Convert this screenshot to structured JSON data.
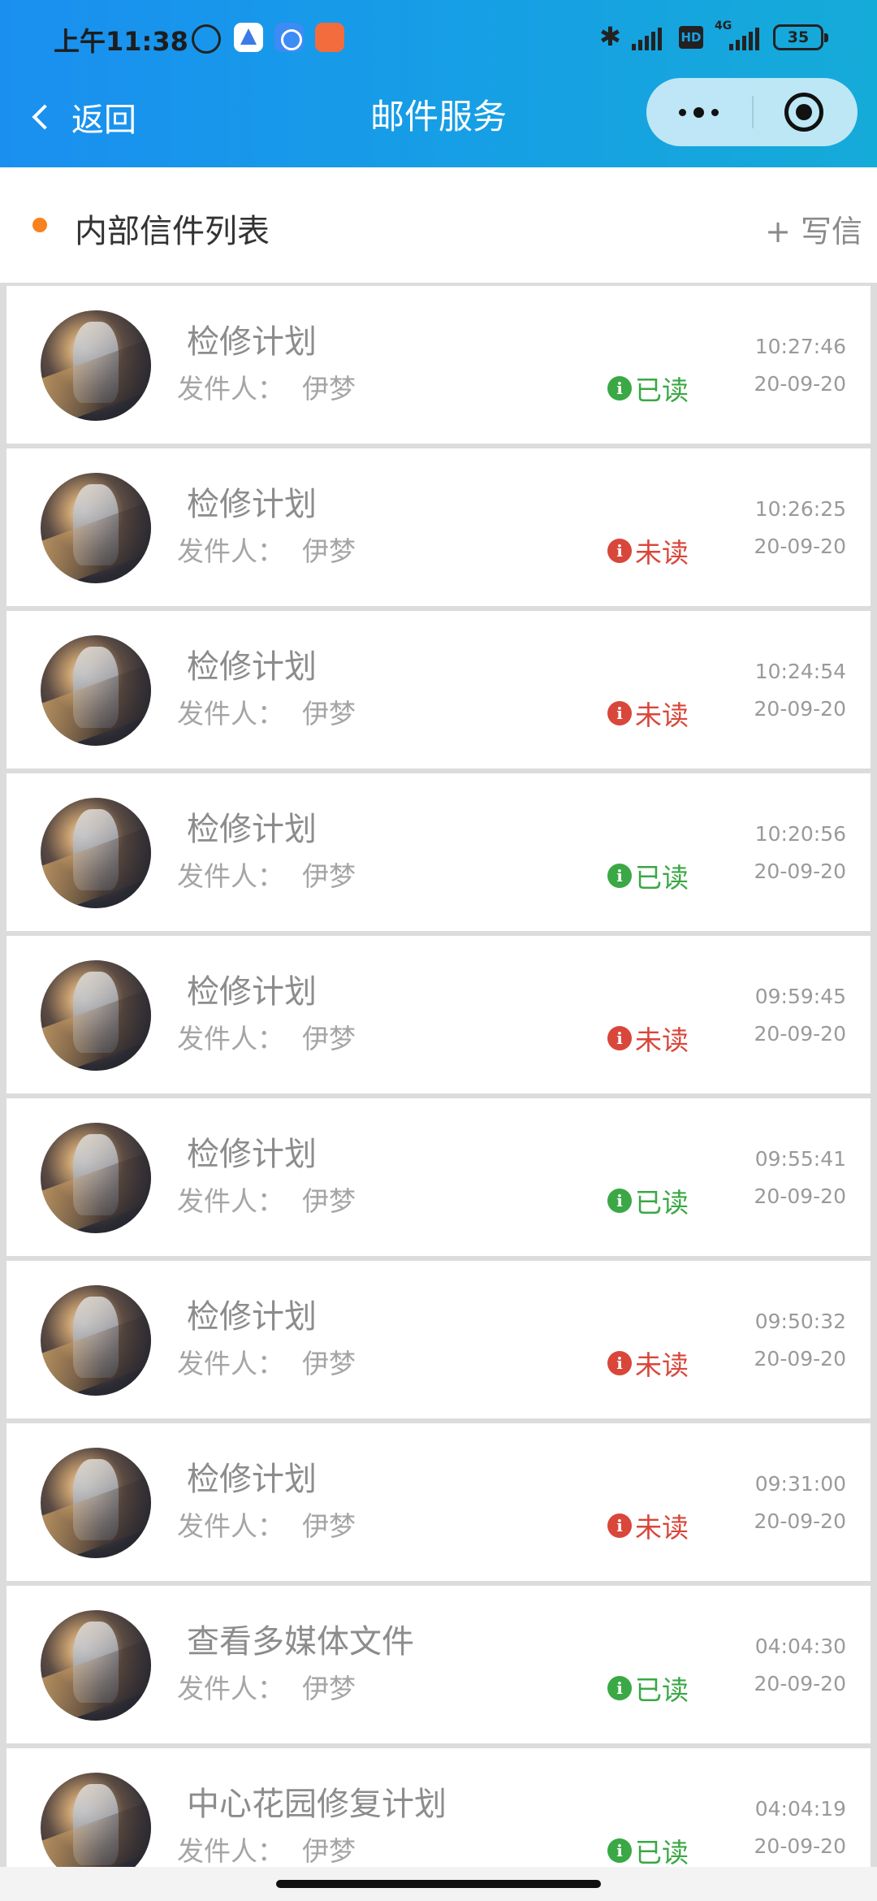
{
  "status_bar": {
    "time": "上午11:38",
    "battery": "35",
    "network_hd": "HD",
    "network_type": "4G",
    "bluetooth_icon": "bluetooth-icon"
  },
  "nav": {
    "back_label": "返回",
    "title": "邮件服务"
  },
  "section": {
    "title": "内部信件列表",
    "compose_label": "+ 写信",
    "accent_color": "#f7821e"
  },
  "mails": [
    {
      "subject": "检修计划",
      "sender_label": "发件人：",
      "sender": "伊梦",
      "status": "已读",
      "read": true,
      "time": "10:27:46",
      "date": "20-09-20"
    },
    {
      "subject": "检修计划",
      "sender_label": "发件人：",
      "sender": "伊梦",
      "status": "未读",
      "read": false,
      "time": "10:26:25",
      "date": "20-09-20"
    },
    {
      "subject": "检修计划",
      "sender_label": "发件人：",
      "sender": "伊梦",
      "status": "未读",
      "read": false,
      "time": "10:24:54",
      "date": "20-09-20"
    },
    {
      "subject": "检修计划",
      "sender_label": "发件人：",
      "sender": "伊梦",
      "status": "已读",
      "read": true,
      "time": "10:20:56",
      "date": "20-09-20"
    },
    {
      "subject": "检修计划",
      "sender_label": "发件人：",
      "sender": "伊梦",
      "status": "未读",
      "read": false,
      "time": "09:59:45",
      "date": "20-09-20"
    },
    {
      "subject": "检修计划",
      "sender_label": "发件人：",
      "sender": "伊梦",
      "status": "已读",
      "read": true,
      "time": "09:55:41",
      "date": "20-09-20"
    },
    {
      "subject": "检修计划",
      "sender_label": "发件人：",
      "sender": "伊梦",
      "status": "未读",
      "read": false,
      "time": "09:50:32",
      "date": "20-09-20"
    },
    {
      "subject": "检修计划",
      "sender_label": "发件人：",
      "sender": "伊梦",
      "status": "未读",
      "read": false,
      "time": "09:31:00",
      "date": "20-09-20"
    },
    {
      "subject": "查看多媒体文件",
      "sender_label": "发件人：",
      "sender": "伊梦",
      "status": "已读",
      "read": true,
      "time": "04:04:30",
      "date": "20-09-20"
    },
    {
      "subject": "中心花园修复计划",
      "sender_label": "发件人：",
      "sender": "伊梦",
      "status": "已读",
      "read": true,
      "time": "04:04:19",
      "date": "20-09-20"
    }
  ],
  "colors": {
    "read": "#3aa845",
    "unread": "#d9463a",
    "header_start": "#1a8ff0",
    "header_end": "#15abd8"
  }
}
